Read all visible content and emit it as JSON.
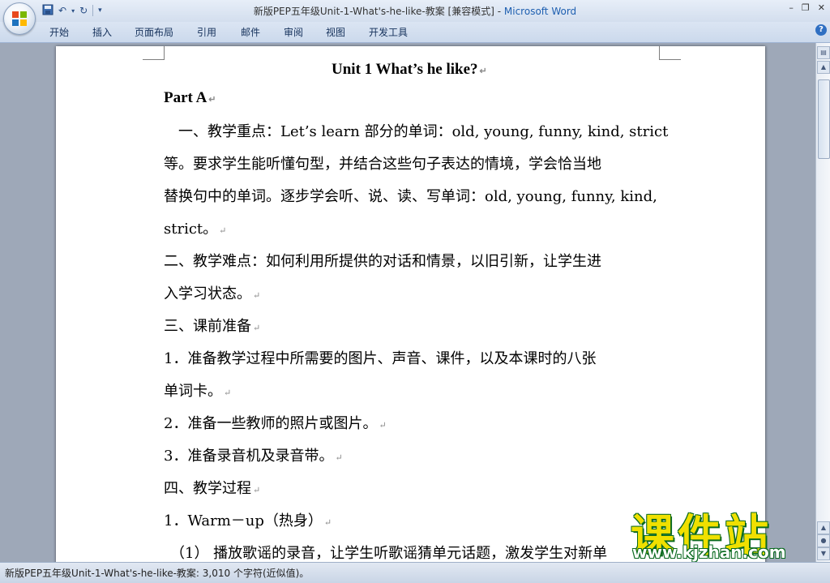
{
  "window": {
    "doc_title": "新版PEP五年级Unit-1-What's-he-like-教案 [兼容模式]",
    "separator": " - ",
    "app_name": "Microsoft Word"
  },
  "ribbon_tabs": [
    "开始",
    "插入",
    "页面布局",
    "引用",
    "邮件",
    "审阅",
    "视图",
    "开发工具"
  ],
  "document": {
    "title": "Unit 1 What’s he like?",
    "part": "Part A",
    "lines": [
      "　一、教学重点：Let’s learn 部分的单词：old, young, funny, kind, strict",
      "等。要求学生能听懂句型，并结合这些句子表达的情境，学会恰当地",
      "替换句中的单词。逐步学会听、说、读、写单词：old, young, funny, kind,",
      "strict。",
      "二、教学难点：如何利用所提供的对话和情景，以旧引新，让学生进",
      "入学习状态。",
      "三、课前准备",
      "1．准备教学过程中所需要的图片、声音、课件，以及本课时的八张",
      "单词卡。",
      "2．准备一些教师的照片或图片。",
      "3．准备录音机及录音带。",
      "四、教学过程",
      "1．Warm－up（热身）",
      "（1）  播放歌谣的录音，让学生听歌谣猜单元话题，激发学生对新单"
    ],
    "paragraph_mark": "↵"
  },
  "watermark": {
    "name": "课件站",
    "url": "www.kjzhan.com"
  },
  "status": {
    "text": "新版PEP五年级Unit-1-What's-he-like-教案: 3,010 个字符(近似值)。"
  },
  "colors": {
    "app_name": "#1e5fb0",
    "watermark_yellow": "#f0e000",
    "watermark_outline": "#0a6a20"
  }
}
